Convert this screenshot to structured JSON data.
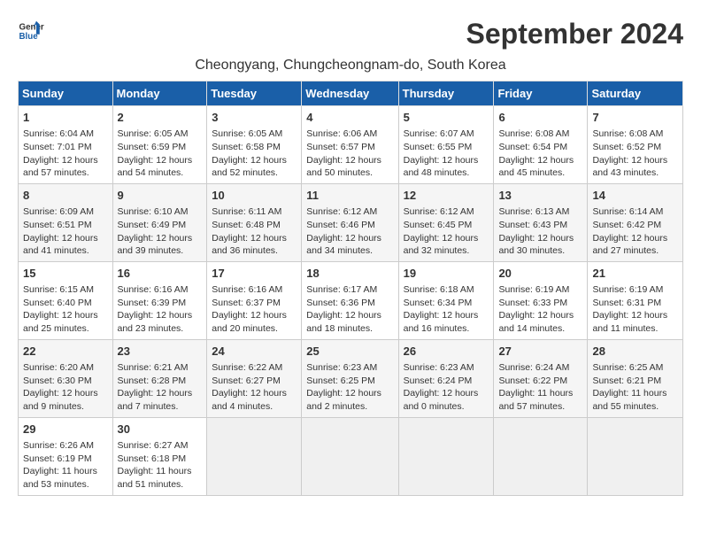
{
  "header": {
    "logo_line1": "General",
    "logo_line2": "Blue",
    "month_title": "September 2024",
    "location": "Cheongyang, Chungcheongnam-do, South Korea"
  },
  "weekdays": [
    "Sunday",
    "Monday",
    "Tuesday",
    "Wednesday",
    "Thursday",
    "Friday",
    "Saturday"
  ],
  "weeks": [
    [
      {
        "day": "1",
        "sunrise": "Sunrise: 6:04 AM",
        "sunset": "Sunset: 7:01 PM",
        "daylight": "Daylight: 12 hours and 57 minutes."
      },
      {
        "day": "2",
        "sunrise": "Sunrise: 6:05 AM",
        "sunset": "Sunset: 6:59 PM",
        "daylight": "Daylight: 12 hours and 54 minutes."
      },
      {
        "day": "3",
        "sunrise": "Sunrise: 6:05 AM",
        "sunset": "Sunset: 6:58 PM",
        "daylight": "Daylight: 12 hours and 52 minutes."
      },
      {
        "day": "4",
        "sunrise": "Sunrise: 6:06 AM",
        "sunset": "Sunset: 6:57 PM",
        "daylight": "Daylight: 12 hours and 50 minutes."
      },
      {
        "day": "5",
        "sunrise": "Sunrise: 6:07 AM",
        "sunset": "Sunset: 6:55 PM",
        "daylight": "Daylight: 12 hours and 48 minutes."
      },
      {
        "day": "6",
        "sunrise": "Sunrise: 6:08 AM",
        "sunset": "Sunset: 6:54 PM",
        "daylight": "Daylight: 12 hours and 45 minutes."
      },
      {
        "day": "7",
        "sunrise": "Sunrise: 6:08 AM",
        "sunset": "Sunset: 6:52 PM",
        "daylight": "Daylight: 12 hours and 43 minutes."
      }
    ],
    [
      {
        "day": "8",
        "sunrise": "Sunrise: 6:09 AM",
        "sunset": "Sunset: 6:51 PM",
        "daylight": "Daylight: 12 hours and 41 minutes."
      },
      {
        "day": "9",
        "sunrise": "Sunrise: 6:10 AM",
        "sunset": "Sunset: 6:49 PM",
        "daylight": "Daylight: 12 hours and 39 minutes."
      },
      {
        "day": "10",
        "sunrise": "Sunrise: 6:11 AM",
        "sunset": "Sunset: 6:48 PM",
        "daylight": "Daylight: 12 hours and 36 minutes."
      },
      {
        "day": "11",
        "sunrise": "Sunrise: 6:12 AM",
        "sunset": "Sunset: 6:46 PM",
        "daylight": "Daylight: 12 hours and 34 minutes."
      },
      {
        "day": "12",
        "sunrise": "Sunrise: 6:12 AM",
        "sunset": "Sunset: 6:45 PM",
        "daylight": "Daylight: 12 hours and 32 minutes."
      },
      {
        "day": "13",
        "sunrise": "Sunrise: 6:13 AM",
        "sunset": "Sunset: 6:43 PM",
        "daylight": "Daylight: 12 hours and 30 minutes."
      },
      {
        "day": "14",
        "sunrise": "Sunrise: 6:14 AM",
        "sunset": "Sunset: 6:42 PM",
        "daylight": "Daylight: 12 hours and 27 minutes."
      }
    ],
    [
      {
        "day": "15",
        "sunrise": "Sunrise: 6:15 AM",
        "sunset": "Sunset: 6:40 PM",
        "daylight": "Daylight: 12 hours and 25 minutes."
      },
      {
        "day": "16",
        "sunrise": "Sunrise: 6:16 AM",
        "sunset": "Sunset: 6:39 PM",
        "daylight": "Daylight: 12 hours and 23 minutes."
      },
      {
        "day": "17",
        "sunrise": "Sunrise: 6:16 AM",
        "sunset": "Sunset: 6:37 PM",
        "daylight": "Daylight: 12 hours and 20 minutes."
      },
      {
        "day": "18",
        "sunrise": "Sunrise: 6:17 AM",
        "sunset": "Sunset: 6:36 PM",
        "daylight": "Daylight: 12 hours and 18 minutes."
      },
      {
        "day": "19",
        "sunrise": "Sunrise: 6:18 AM",
        "sunset": "Sunset: 6:34 PM",
        "daylight": "Daylight: 12 hours and 16 minutes."
      },
      {
        "day": "20",
        "sunrise": "Sunrise: 6:19 AM",
        "sunset": "Sunset: 6:33 PM",
        "daylight": "Daylight: 12 hours and 14 minutes."
      },
      {
        "day": "21",
        "sunrise": "Sunrise: 6:19 AM",
        "sunset": "Sunset: 6:31 PM",
        "daylight": "Daylight: 12 hours and 11 minutes."
      }
    ],
    [
      {
        "day": "22",
        "sunrise": "Sunrise: 6:20 AM",
        "sunset": "Sunset: 6:30 PM",
        "daylight": "Daylight: 12 hours and 9 minutes."
      },
      {
        "day": "23",
        "sunrise": "Sunrise: 6:21 AM",
        "sunset": "Sunset: 6:28 PM",
        "daylight": "Daylight: 12 hours and 7 minutes."
      },
      {
        "day": "24",
        "sunrise": "Sunrise: 6:22 AM",
        "sunset": "Sunset: 6:27 PM",
        "daylight": "Daylight: 12 hours and 4 minutes."
      },
      {
        "day": "25",
        "sunrise": "Sunrise: 6:23 AM",
        "sunset": "Sunset: 6:25 PM",
        "daylight": "Daylight: 12 hours and 2 minutes."
      },
      {
        "day": "26",
        "sunrise": "Sunrise: 6:23 AM",
        "sunset": "Sunset: 6:24 PM",
        "daylight": "Daylight: 12 hours and 0 minutes."
      },
      {
        "day": "27",
        "sunrise": "Sunrise: 6:24 AM",
        "sunset": "Sunset: 6:22 PM",
        "daylight": "Daylight: 11 hours and 57 minutes."
      },
      {
        "day": "28",
        "sunrise": "Sunrise: 6:25 AM",
        "sunset": "Sunset: 6:21 PM",
        "daylight": "Daylight: 11 hours and 55 minutes."
      }
    ],
    [
      {
        "day": "29",
        "sunrise": "Sunrise: 6:26 AM",
        "sunset": "Sunset: 6:19 PM",
        "daylight": "Daylight: 11 hours and 53 minutes."
      },
      {
        "day": "30",
        "sunrise": "Sunrise: 6:27 AM",
        "sunset": "Sunset: 6:18 PM",
        "daylight": "Daylight: 11 hours and 51 minutes."
      },
      {
        "day": "",
        "sunrise": "",
        "sunset": "",
        "daylight": ""
      },
      {
        "day": "",
        "sunrise": "",
        "sunset": "",
        "daylight": ""
      },
      {
        "day": "",
        "sunrise": "",
        "sunset": "",
        "daylight": ""
      },
      {
        "day": "",
        "sunrise": "",
        "sunset": "",
        "daylight": ""
      },
      {
        "day": "",
        "sunrise": "",
        "sunset": "",
        "daylight": ""
      }
    ]
  ]
}
